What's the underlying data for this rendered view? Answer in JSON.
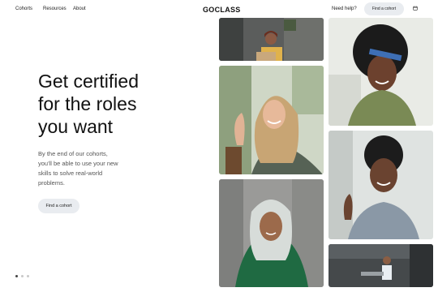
{
  "nav": {
    "links": [
      "Cohorts",
      "Resources",
      "About"
    ],
    "logo": "GOCLASS",
    "help": "Need help?",
    "find_button": "Find a cohort",
    "calendar_icon": "calendar-icon"
  },
  "hero": {
    "title_lines": [
      "Get certified",
      "for the roles",
      "you want"
    ],
    "subtitle_lines": [
      "By the end of our cohorts,",
      "you'll be able to use your new",
      "skills to solve real-world",
      "problems."
    ],
    "cta": "Find a cohort"
  },
  "carousel": {
    "count": 3,
    "active": 0
  },
  "colors": {
    "accent_bg": "#e9ecf0",
    "text": "#111111",
    "muted": "#555555"
  }
}
